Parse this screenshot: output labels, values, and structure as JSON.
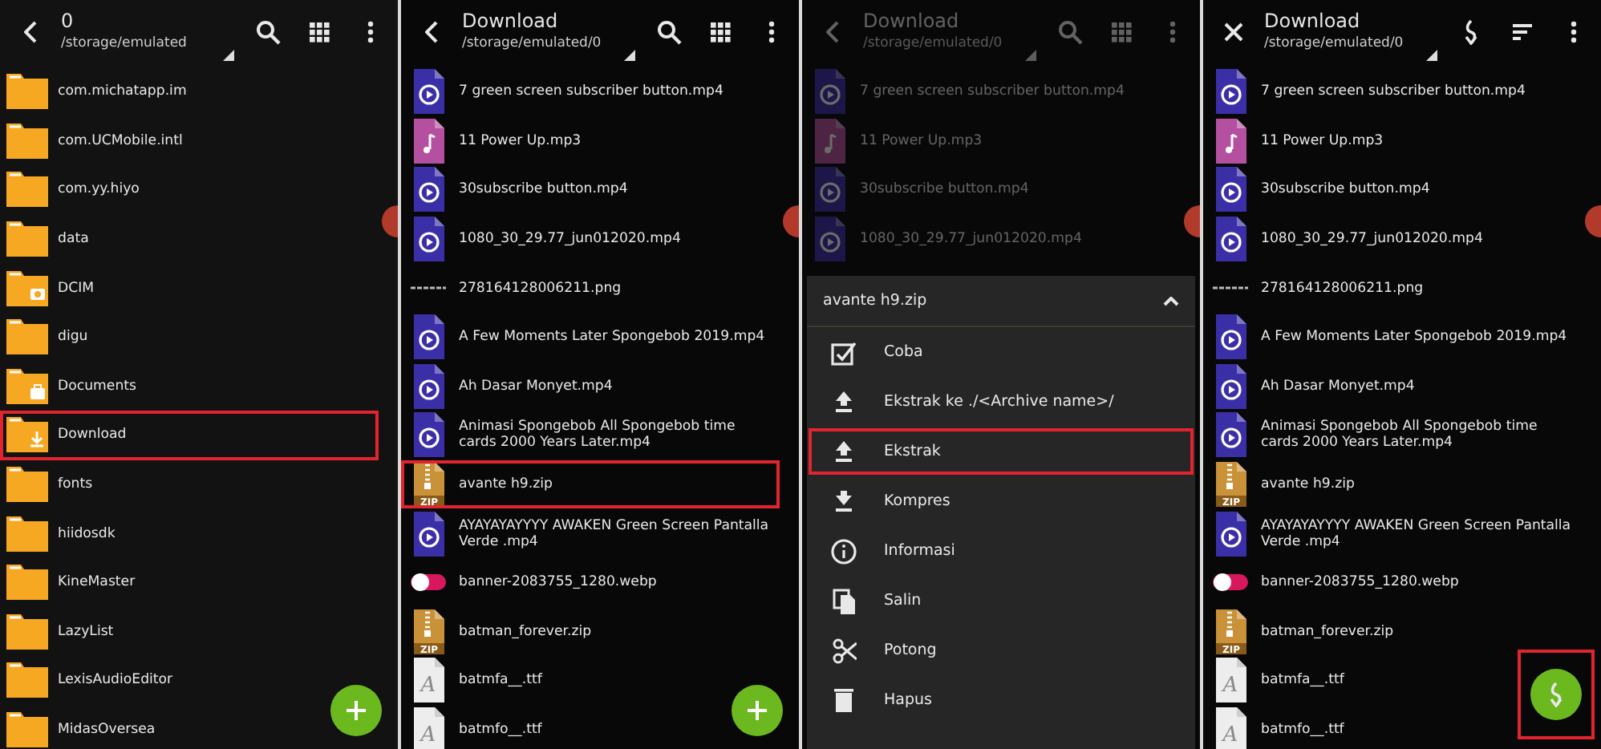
{
  "panels": [
    {
      "kind": "folders",
      "header": {
        "lead": {
          "kind": "back"
        },
        "title": "0",
        "path": "/storage/emulated",
        "actions": [
          {
            "kind": "search"
          },
          {
            "kind": "grid"
          },
          {
            "kind": "more"
          }
        ]
      },
      "edit_bubble": true,
      "items": [
        {
          "kind": "folder",
          "label": "com.michatapp.im",
          "highlighted": false
        },
        {
          "kind": "folder",
          "label": "com.UCMobile.intl",
          "highlighted": false
        },
        {
          "kind": "folder",
          "label": "com.yy.hiyo",
          "highlighted": false
        },
        {
          "kind": "folder",
          "label": "data",
          "highlighted": false
        },
        {
          "kind": "camera-folder",
          "label": "DCIM",
          "highlighted": false
        },
        {
          "kind": "folder",
          "label": "digu",
          "highlighted": false
        },
        {
          "kind": "case-folder",
          "label": "Documents",
          "highlighted": false
        },
        {
          "kind": "download-folder",
          "label": "Download",
          "highlighted": true
        },
        {
          "kind": "folder",
          "label": "fonts",
          "highlighted": false
        },
        {
          "kind": "folder",
          "label": "hiidosdk",
          "highlighted": false
        },
        {
          "kind": "folder",
          "label": "KineMaster",
          "highlighted": false
        },
        {
          "kind": "folder",
          "label": "LazyList",
          "highlighted": false
        },
        {
          "kind": "folder",
          "label": "LexisAudioEditor",
          "highlighted": false
        },
        {
          "kind": "folder",
          "label": "MidasOversea",
          "highlighted": false
        }
      ],
      "fab": {
        "kind": "plus"
      }
    },
    {
      "kind": "files",
      "header": {
        "lead": {
          "kind": "back"
        },
        "title": "Download",
        "path": "/storage/emulated/0",
        "actions": [
          {
            "kind": "search"
          },
          {
            "kind": "grid"
          },
          {
            "kind": "more"
          }
        ]
      },
      "edit_bubble": true,
      "items": [
        {
          "kind": "video",
          "label": "7 green screen subscriber button.mp4",
          "highlighted": false
        },
        {
          "kind": "audio",
          "label": "11 Power Up.mp3",
          "highlighted": false
        },
        {
          "kind": "video",
          "label": "30subscribe button.mp4",
          "highlighted": false
        },
        {
          "kind": "video",
          "label": "1080_30_29.77_jun012020.mp4",
          "highlighted": false
        },
        {
          "kind": "image",
          "label": "278164128006211.png",
          "highlighted": false
        },
        {
          "kind": "video",
          "label": "A Few Moments Later Spongebob 2019.mp4",
          "highlighted": false
        },
        {
          "kind": "video",
          "label": "Ah Dasar Monyet.mp4",
          "highlighted": false
        },
        {
          "kind": "video",
          "label": "Animasi Spongebob All Spongebob time cards 2000 Years Later.mp4",
          "highlighted": false
        },
        {
          "kind": "zip",
          "label": "avante h9.zip",
          "badge": "ZIP",
          "highlighted": true
        },
        {
          "kind": "video",
          "label": "AYAYAYAYYYY  AWAKEN  Green Screen  Pantalla Verde .mp4",
          "highlighted": false
        },
        {
          "kind": "banner",
          "label": "banner-2083755_1280.webp",
          "highlighted": false
        },
        {
          "kind": "zip",
          "label": "batman_forever.zip",
          "badge": "ZIP",
          "highlighted": false
        },
        {
          "kind": "font",
          "label": "batmfa__.ttf",
          "badge": "A",
          "highlighted": false
        },
        {
          "kind": "font",
          "label": "batmfo__.ttf",
          "badge": "A",
          "highlighted": false
        }
      ],
      "fab": {
        "kind": "plus"
      }
    },
    {
      "kind": "sheet",
      "header": {
        "lead": {
          "kind": "back"
        },
        "title": "Download",
        "path": "/storage/emulated/0",
        "actions": [
          {
            "kind": "search"
          },
          {
            "kind": "grid"
          },
          {
            "kind": "more"
          }
        ]
      },
      "edit_bubble": true,
      "items": [
        {
          "kind": "video",
          "label": "7 green screen subscriber button.mp4",
          "highlighted": false
        },
        {
          "kind": "audio",
          "label": "11 Power Up.mp3",
          "highlighted": false
        },
        {
          "kind": "video",
          "label": "30subscribe button.mp4",
          "highlighted": false
        },
        {
          "kind": "video",
          "label": "1080_30_29.77_jun012020.mp4",
          "highlighted": false
        }
      ],
      "sheet": {
        "title": "avante h9.zip",
        "options": [
          {
            "kind": "check",
            "label": "Coba",
            "highlighted": false
          },
          {
            "kind": "upload",
            "label": "Ekstrak ke ./<Archive name>/",
            "highlighted": false
          },
          {
            "kind": "upload",
            "label": "Ekstrak",
            "highlighted": true
          },
          {
            "kind": "download",
            "label": "Kompres",
            "highlighted": false
          },
          {
            "kind": "info",
            "label": "Informasi",
            "highlighted": false
          },
          {
            "kind": "copy",
            "label": "Salin",
            "highlighted": false
          },
          {
            "kind": "scissors",
            "label": "Potong",
            "highlighted": false
          },
          {
            "kind": "trash",
            "label": "Hapus",
            "highlighted": false
          }
        ]
      }
    },
    {
      "kind": "files",
      "header": {
        "lead": {
          "kind": "close"
        },
        "title": "Download",
        "path": "/storage/emulated/0",
        "actions": [
          {
            "kind": "extract"
          },
          {
            "kind": "sort"
          },
          {
            "kind": "more"
          }
        ]
      },
      "edit_bubble": true,
      "items": [
        {
          "kind": "video",
          "label": "7 green screen subscriber button.mp4",
          "highlighted": false
        },
        {
          "kind": "audio",
          "label": "11 Power Up.mp3",
          "highlighted": false
        },
        {
          "kind": "video",
          "label": "30subscribe button.mp4",
          "highlighted": false
        },
        {
          "kind": "video",
          "label": "1080_30_29.77_jun012020.mp4",
          "highlighted": false
        },
        {
          "kind": "image",
          "label": "278164128006211.png",
          "highlighted": false
        },
        {
          "kind": "video",
          "label": "A Few Moments Later Spongebob 2019.mp4",
          "highlighted": false
        },
        {
          "kind": "video",
          "label": "Ah Dasar Monyet.mp4",
          "highlighted": false
        },
        {
          "kind": "video",
          "label": "Animasi Spongebob All Spongebob time cards 2000 Years Later.mp4",
          "highlighted": false
        },
        {
          "kind": "zip",
          "label": "avante h9.zip",
          "badge": "ZIP",
          "highlighted": false
        },
        {
          "kind": "video",
          "label": "AYAYAYAYYYY  AWAKEN  Green Screen  Pantalla Verde .mp4",
          "highlighted": false
        },
        {
          "kind": "banner",
          "label": "banner-2083755_1280.webp",
          "highlighted": false
        },
        {
          "kind": "zip",
          "label": "batman_forever.zip",
          "badge": "ZIP",
          "highlighted": false
        },
        {
          "kind": "font",
          "label": "batmfa__.ttf",
          "badge": "A",
          "highlighted": false
        },
        {
          "kind": "font",
          "label": "batmfo__.ttf",
          "badge": "A",
          "highlighted": false
        }
      ],
      "fab": {
        "kind": "extract",
        "highlighted": true
      }
    }
  ]
}
